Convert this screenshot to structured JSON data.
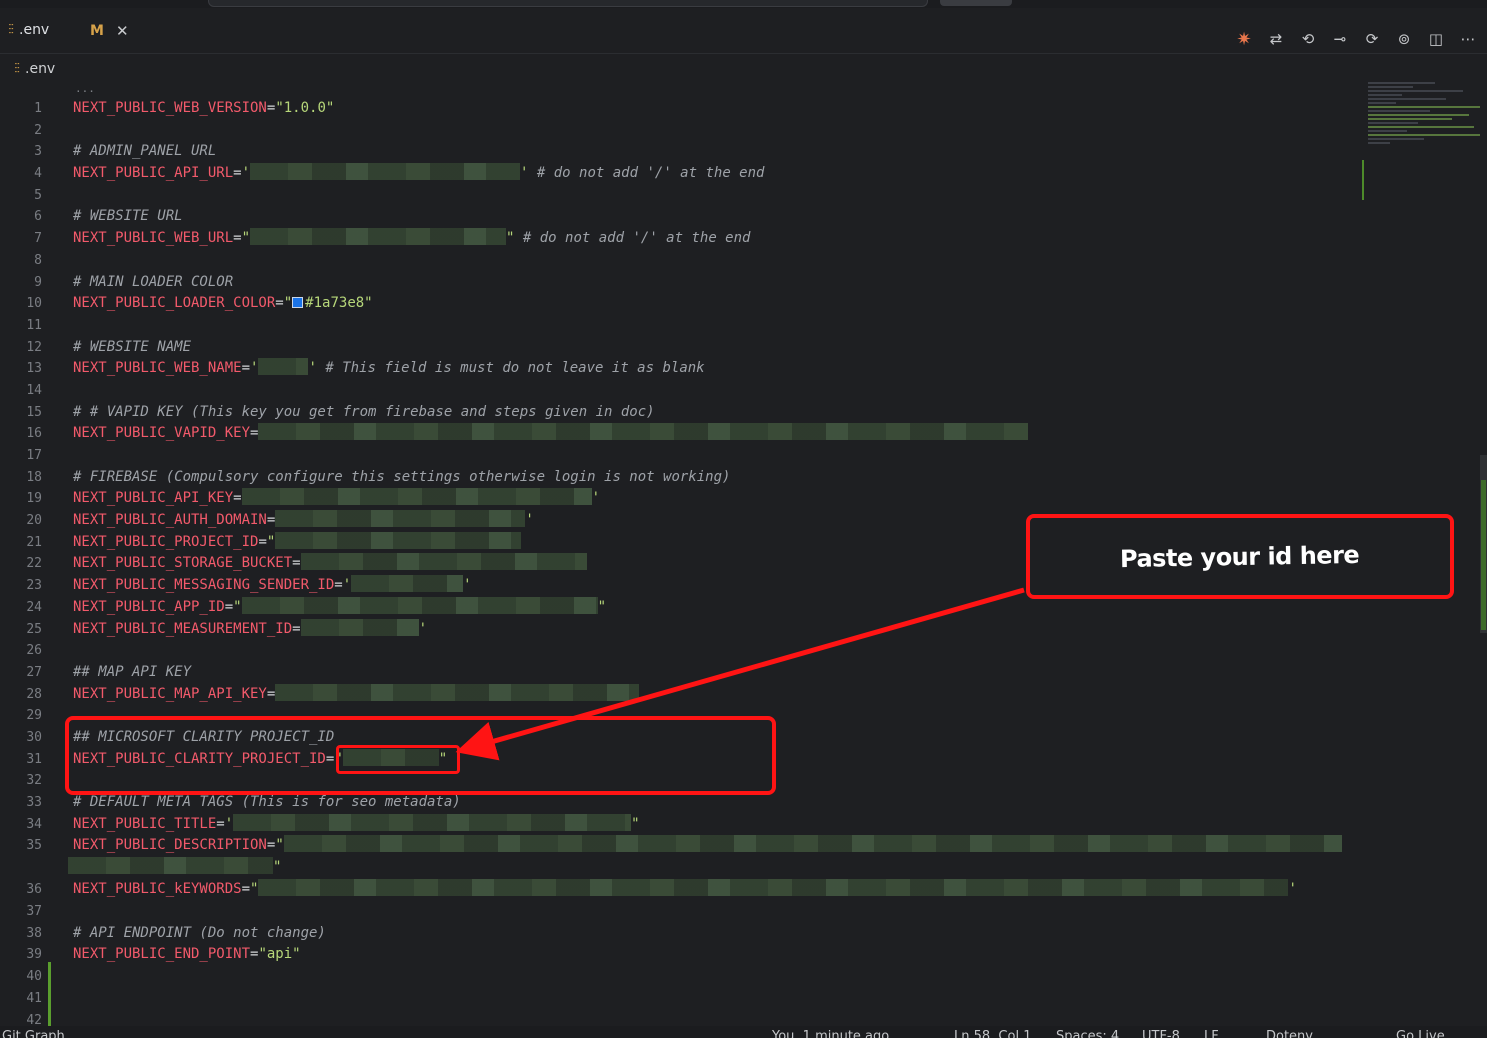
{
  "tabs": [
    {
      "label": ".env",
      "icon": "env-file-icon",
      "active": true
    },
    {
      "badge": "M",
      "close": "✕"
    }
  ],
  "breadcrumb": {
    "file": ".env"
  },
  "editor": {
    "fold_marker": "...",
    "lines": [
      {
        "n": "1",
        "key": "NEXT_PUBLIC_WEB_VERSION",
        "eq": "=",
        "value": "\"1.0.0\""
      },
      {
        "n": "2"
      },
      {
        "n": "3",
        "comment": "# ADMIN_PANEL URL"
      },
      {
        "n": "4",
        "key": "NEXT_PUBLIC_API_URL",
        "eq": "=",
        "open": "'",
        "close": "'",
        "comment": " # do not add '/' at the end"
      },
      {
        "n": "5"
      },
      {
        "n": "6",
        "comment": "# WEBSITE URL"
      },
      {
        "n": "7",
        "key": "NEXT_PUBLIC_WEB_URL",
        "eq": "=",
        "open": "\"",
        "close": "\"",
        "comment": " # do not add '/' at the end"
      },
      {
        "n": "8"
      },
      {
        "n": "9",
        "comment": "# MAIN LOADER COLOR"
      },
      {
        "n": "10",
        "key": "NEXT_PUBLIC_LOADER_COLOR",
        "eq": "=",
        "open": "\"",
        "value": "#1a73e8\""
      },
      {
        "n": "11"
      },
      {
        "n": "12",
        "comment": "# WEBSITE NAME"
      },
      {
        "n": "13",
        "key": "NEXT_PUBLIC_WEB_NAME",
        "eq": "=",
        "open": "'",
        "close": "'",
        "comment": " # This field is must do not leave it as blank"
      },
      {
        "n": "14"
      },
      {
        "n": "15",
        "comment": "# # VAPID KEY (This key you get from firebase and steps given in doc)"
      },
      {
        "n": "16",
        "key": "NEXT_PUBLIC_VAPID_KEY",
        "eq": "="
      },
      {
        "n": "17"
      },
      {
        "n": "18",
        "comment": "# FIREBASE (Compulsory configure this settings otherwise login is not working)"
      },
      {
        "n": "19",
        "key": "NEXT_PUBLIC_API_KEY",
        "eq": "=",
        "close": "'"
      },
      {
        "n": "20",
        "key": "NEXT_PUBLIC_AUTH_DOMAIN",
        "eq": "=",
        "close": "'"
      },
      {
        "n": "21",
        "key": "NEXT_PUBLIC_PROJECT_ID",
        "eq": "=",
        "open": "\""
      },
      {
        "n": "22",
        "key": "NEXT_PUBLIC_STORAGE_BUCKET",
        "eq": "="
      },
      {
        "n": "23",
        "key": "NEXT_PUBLIC_MESSAGING_SENDER_ID",
        "eq": "=",
        "open": "'",
        "close": "'"
      },
      {
        "n": "24",
        "key": "NEXT_PUBLIC_APP_ID",
        "eq": "=",
        "open": "\"",
        "close": "\""
      },
      {
        "n": "25",
        "key": "NEXT_PUBLIC_MEASUREMENT_ID",
        "eq": "=",
        "close": "'"
      },
      {
        "n": "26"
      },
      {
        "n": "27",
        "comment": "## MAP API KEY"
      },
      {
        "n": "28",
        "key": "NEXT_PUBLIC_MAP_API_KEY",
        "eq": "="
      },
      {
        "n": "29"
      },
      {
        "n": "30",
        "comment": "## MICROSOFT CLARITY PROJECT_ID"
      },
      {
        "n": "31",
        "key": "NEXT_PUBLIC_CLARITY_PROJECT_ID",
        "eq": "=",
        "open": "\"",
        "close": "\""
      },
      {
        "n": "32"
      },
      {
        "n": "33",
        "comment": "# DEFAULT META TAGS (This is for seo metadata)"
      },
      {
        "n": "34",
        "key": "NEXT_PUBLIC_TITLE",
        "eq": "=",
        "open": "'",
        "close": "\""
      },
      {
        "n": "35",
        "key": "NEXT_PUBLIC_DESCRIPTION",
        "eq": "=",
        "open": "\"",
        "close": "\""
      },
      {
        "n": "36",
        "key": "NEXT_PUBLIC_kEYWORDS",
        "eq": "=",
        "open": "\"",
        "close": "'"
      },
      {
        "n": "37"
      },
      {
        "n": "38",
        "comment": "# API ENDPOINT (Do not change)"
      },
      {
        "n": "39",
        "key": "NEXT_PUBLIC_END_POINT",
        "eq": "=",
        "value": "\"api\""
      },
      {
        "n": "40"
      },
      {
        "n": "41"
      },
      {
        "n": "42"
      }
    ]
  },
  "annotation": {
    "callout_text": "Paste your id here",
    "color": "#ff1414"
  },
  "status_bar": {
    "left": "Git Graph",
    "blame": "You, 1 minute ago",
    "position": "Ln 58, Col 1",
    "spaces": "Spaces: 4",
    "encoding": "UTF-8",
    "eol": "LF",
    "language": "Dotenv",
    "golive": "Go Live"
  },
  "colors": {
    "key": "#f25a6b",
    "string": "#b7d77a",
    "comment": "#9ea2a8",
    "loader": "#1a73e8"
  }
}
